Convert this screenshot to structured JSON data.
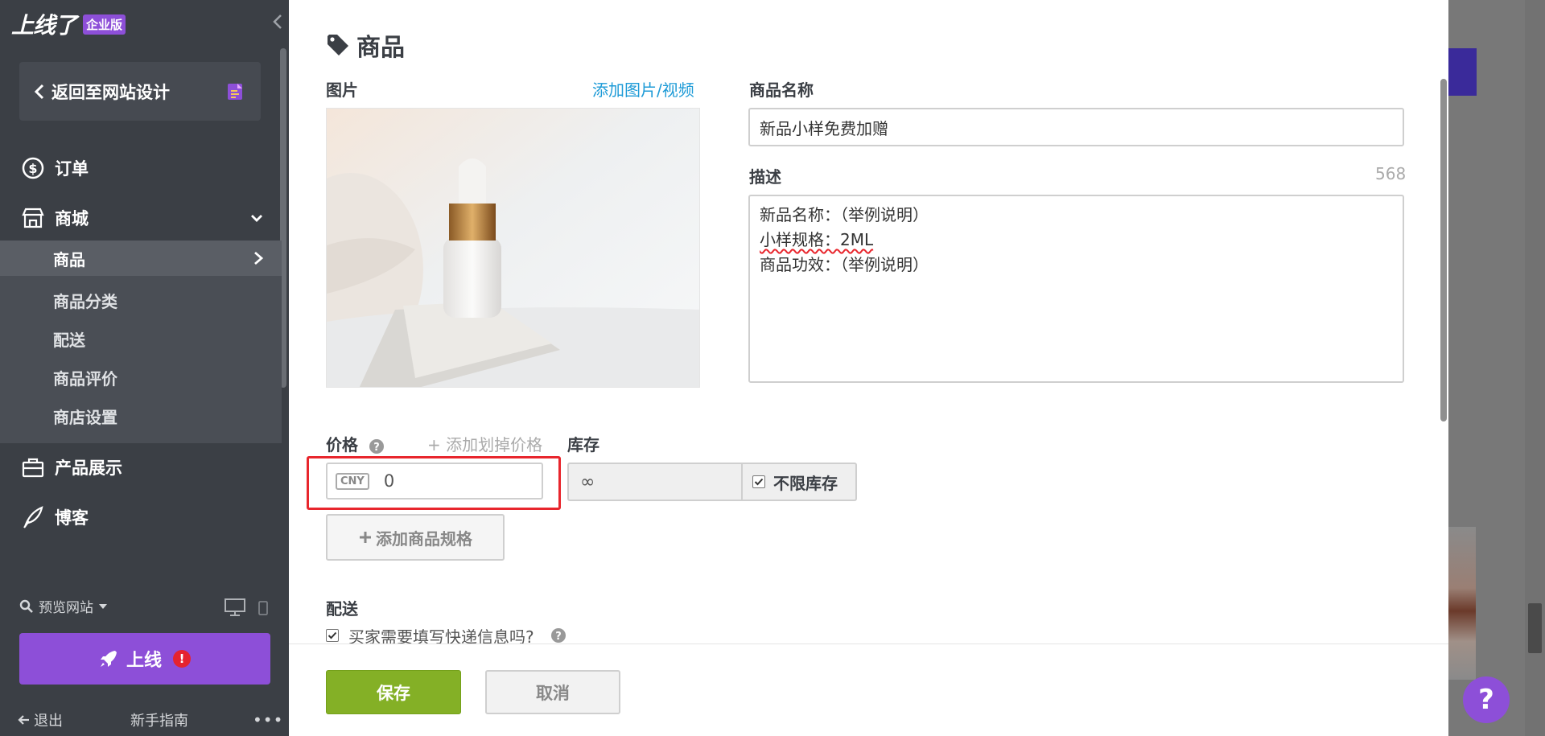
{
  "sidebar": {
    "logo": "上线了",
    "badge": "企业版",
    "back_label": "返回至网站设计",
    "nav": {
      "orders": "订单",
      "mall": "商城",
      "showcase": "产品展示",
      "blog": "博客"
    },
    "submenu": [
      {
        "label": "商品",
        "active": true
      },
      {
        "label": "商品分类"
      },
      {
        "label": "配送"
      },
      {
        "label": "商品评价"
      },
      {
        "label": "商店设置"
      }
    ],
    "preview_label": "预览网站",
    "publish_label": "上线",
    "alert_mark": "!",
    "logout_label": "退出",
    "guide_label": "新手指南",
    "more_label": "•••"
  },
  "main": {
    "title": "商品",
    "image_label": "图片",
    "add_media_link": "添加图片/视频",
    "name_label": "商品名称",
    "name_value": "新品小样免费加赠",
    "desc_label": "描述",
    "desc_counter": "568",
    "desc_lines": [
      "新品名称：（举例说明）",
      "小样规格：2ML",
      "商品功效：（举例说明）"
    ],
    "price_label": "价格",
    "add_strike_price": "+ 添加划掉价格",
    "currency": "CNY",
    "price_value": "0",
    "stock_label": "库存",
    "stock_value": "∞",
    "unlimited_stock_label": "不限库存",
    "unlimited_stock_checked": true,
    "add_spec_label": "添加商品规格",
    "shipping_label": "配送",
    "shipping_question": "买家需要填写快递信息吗?",
    "save_label": "保存",
    "cancel_label": "取消"
  },
  "help_fab": "?",
  "colors": {
    "accent_purple": "#8d4fd8",
    "sidebar_bg": "#3b3f45",
    "save_green": "#84b026",
    "link_blue": "#1e9bd7",
    "highlight_red": "#e8262d"
  }
}
